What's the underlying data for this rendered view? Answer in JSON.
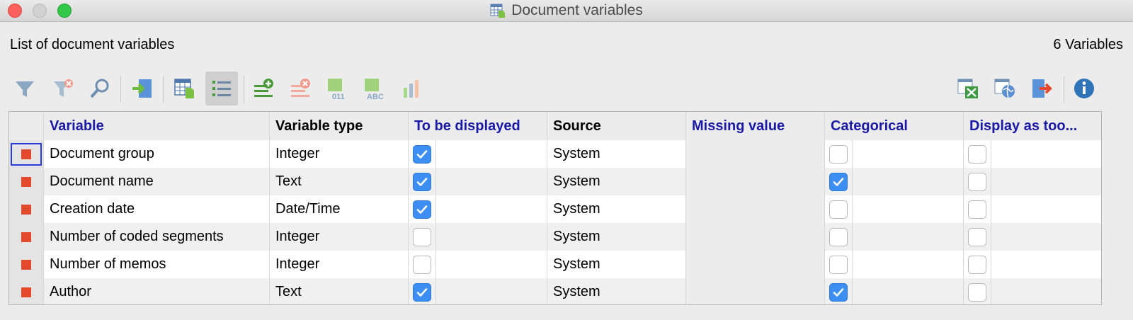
{
  "window": {
    "title": "Document variables"
  },
  "header": {
    "list_title": "List of document variables",
    "count_label": "6 Variables"
  },
  "toolbar": {
    "left": [
      "filter-icon",
      "clear-filter-icon",
      "search-icon",
      "import-icon",
      "table-view-icon",
      "list-view-icon",
      "add-variable-icon",
      "delete-variable-icon",
      "numeric-variable-icon",
      "text-variable-icon",
      "chart-icon"
    ],
    "right": [
      "export-excel-icon",
      "export-html-icon",
      "exit-icon",
      "info-icon"
    ]
  },
  "columns": [
    "Variable",
    "Variable type",
    "To be displayed",
    "Source",
    "Missing value",
    "Categorical",
    "Display as too..."
  ],
  "rows": [
    {
      "variable": "Document group",
      "type": "Integer",
      "displayed": true,
      "source": "System",
      "missing": "",
      "categorical": false,
      "tooltip": false
    },
    {
      "variable": "Document name",
      "type": "Text",
      "displayed": true,
      "source": "System",
      "missing": "",
      "categorical": true,
      "tooltip": false
    },
    {
      "variable": "Creation date",
      "type": "Date/Time",
      "displayed": true,
      "source": "System",
      "missing": "",
      "categorical": false,
      "tooltip": false
    },
    {
      "variable": "Number of coded segments",
      "type": "Integer",
      "displayed": false,
      "source": "System",
      "missing": "",
      "categorical": false,
      "tooltip": false
    },
    {
      "variable": "Number of memos",
      "type": "Integer",
      "displayed": false,
      "source": "System",
      "missing": "",
      "categorical": false,
      "tooltip": false
    },
    {
      "variable": "Author",
      "type": "Text",
      "displayed": true,
      "source": "System",
      "missing": "",
      "categorical": true,
      "tooltip": false
    }
  ],
  "colors": {
    "accent": "#3d8ef2",
    "marker": "#e2492d",
    "header_blue": "#1a1aa6"
  }
}
